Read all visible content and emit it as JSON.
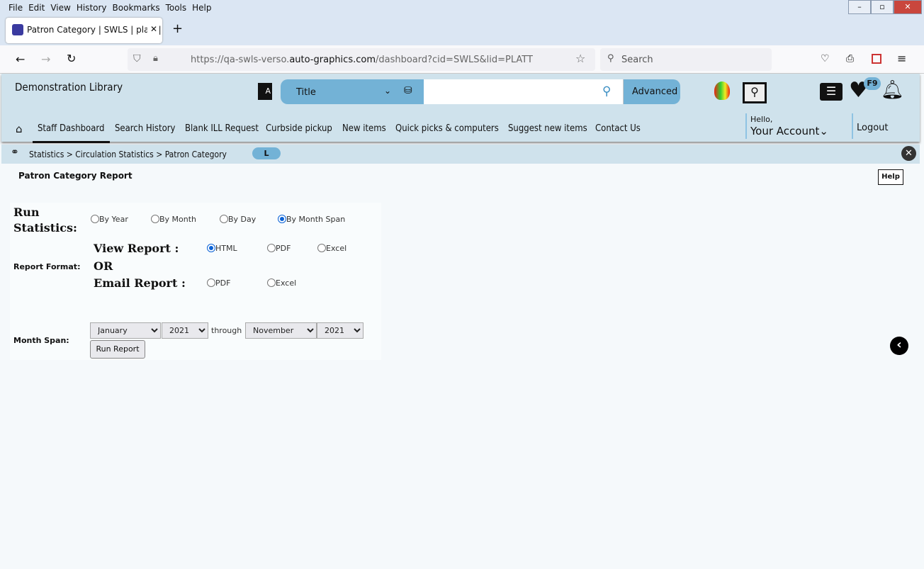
{
  "browser": {
    "menu": [
      "File",
      "Edit",
      "View",
      "History",
      "Bookmarks",
      "Tools",
      "Help"
    ],
    "tab_title": "Patron Category | SWLS | platt |",
    "url_prefix": "https://qa-swls-verso.",
    "url_domain": "auto-graphics.com",
    "url_path": "/dashboard?cid=SWLS&lid=PLATT",
    "search_placeholder": "Search"
  },
  "header": {
    "library": "Demonstration Library",
    "search_type": "Title",
    "advanced": "Advanced",
    "f9_badge": "F9",
    "hello": "Hello,",
    "account": "Your Account",
    "logout": "Logout"
  },
  "nav": [
    "Staff Dashboard",
    "Search History",
    "Blank ILL Request",
    "Curbside pickup",
    "New items",
    "Quick picks & computers",
    "Suggest new items",
    "Contact Us"
  ],
  "breadcrumb": {
    "text": "Statistics > Circulation Statistics > Patron Category",
    "badge": "L"
  },
  "page": {
    "title": "Patron Category Report",
    "help": "Help",
    "run_statistics_label": "Run Statistics:",
    "run_options": [
      "By Year",
      "By Month",
      "By Day",
      "By Month Span"
    ],
    "run_selected": "By Month Span",
    "report_format_label": "Report Format:",
    "view_report": "View Report :",
    "view_options": [
      "HTML",
      "PDF",
      "Excel"
    ],
    "view_selected": "HTML",
    "or": "OR",
    "email_report": "Email Report :",
    "email_options": [
      "PDF",
      "Excel"
    ],
    "month_span_label": "Month Span:",
    "from_month": "January",
    "from_year": "2021",
    "through": "through",
    "to_month": "November",
    "to_year": "2021",
    "run_report": "Run Report"
  },
  "colors": {
    "header_bg": "#cfe2ec",
    "search_bar": "#73b2d6",
    "radio_selected": "#0a62d6"
  }
}
